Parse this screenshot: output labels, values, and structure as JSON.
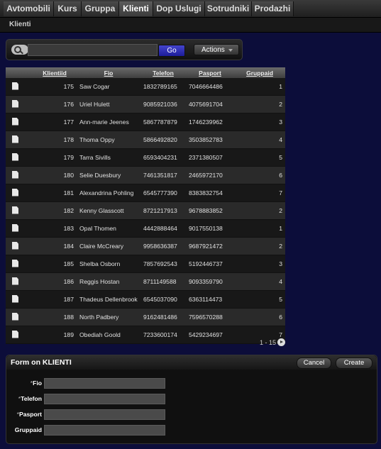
{
  "tabs": [
    {
      "label": "Avtomobili"
    },
    {
      "label": "Kurs"
    },
    {
      "label": "Gruppa"
    },
    {
      "label": "Klienti",
      "active": true
    },
    {
      "label": "Dop Uslugi"
    },
    {
      "label": "Sotrudniki"
    },
    {
      "label": "Prodazhi"
    }
  ],
  "breadcrumb": "Klienti",
  "search": {
    "value": "",
    "go_label": "Go",
    "actions_label": "Actions"
  },
  "table": {
    "columns": [
      "Klientiid",
      "Fio",
      "Telefon",
      "Pasport",
      "Gruppaid"
    ],
    "rows": [
      [
        "175",
        "Saw Cogar",
        "1832789165",
        "7046664486",
        "1"
      ],
      [
        "176",
        "Uriel Hulett",
        "9085921036",
        "4075691704",
        "2"
      ],
      [
        "177",
        "Ann-marie Jeenes",
        "5867787879",
        "1746239962",
        "3"
      ],
      [
        "178",
        "Thoma Oppy",
        "5866492820",
        "3503852783",
        "4"
      ],
      [
        "179",
        "Tarra Sivills",
        "6593404231",
        "2371380507",
        "5"
      ],
      [
        "180",
        "Selie Duesbury",
        "7461351817",
        "2465972170",
        "6"
      ],
      [
        "181",
        "Alexandrina Pohling",
        "6545777390",
        "8383832754",
        "7"
      ],
      [
        "182",
        "Kenny Glasscott",
        "8721217913",
        "9678883852",
        "2"
      ],
      [
        "183",
        "Opal Thomen",
        "4442888464",
        "9017550138",
        "1"
      ],
      [
        "184",
        "Claire McCreary",
        "9958636387",
        "9687921472",
        "2"
      ],
      [
        "185",
        "Shelba Osborn",
        "7857692543",
        "5192446737",
        "3"
      ],
      [
        "186",
        "Reggis Hostan",
        "8711149588",
        "9093359790",
        "4"
      ],
      [
        "187",
        "Thadeus Dellenbrook",
        "6545037090",
        "6363114473",
        "5"
      ],
      [
        "188",
        "North Padbery",
        "9162481486",
        "7596570288",
        "6"
      ],
      [
        "189",
        "Obediah Goold",
        "7233600174",
        "5429234697",
        "7"
      ]
    ]
  },
  "pagination": "1 - 15",
  "form": {
    "title": "Form on KLIENTI",
    "cancel_label": "Cancel",
    "create_label": "Create",
    "required_marker": "*",
    "fields": [
      {
        "label": "Fio",
        "required": true,
        "value": ""
      },
      {
        "label": "Telefon",
        "required": true,
        "value": ""
      },
      {
        "label": "Pasport",
        "required": true,
        "value": ""
      },
      {
        "label": "Gruppaid",
        "required": false,
        "value": ""
      }
    ]
  }
}
